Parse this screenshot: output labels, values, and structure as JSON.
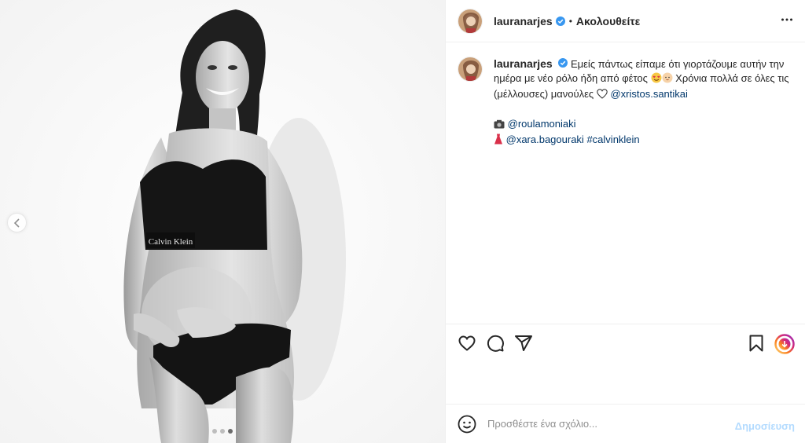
{
  "post": {
    "username": "lauranarjes",
    "follow_status": "Ακολουθείτε",
    "separator": "•",
    "caption": {
      "line1": "Εμείς πάντως είπαμε ότι γιορτάζουμε αυτήν την ημέρα με νέο ρόλο ήδη από φέτος",
      "line2": " Χρόνια πολλά σε όλες τις (μέλλουσες) μανούλες",
      "mention_main": "@xristos.santikai",
      "credit_photo": "@roulamoniaki",
      "credit_style": "@xara.bagouraki",
      "hashtag": "#calvinklein"
    },
    "photo_brand_text": "Calvin Klein",
    "carousel": {
      "count": 3,
      "active_index": 2
    }
  },
  "comment": {
    "placeholder": "Προσθέστε ένα σχόλιο...",
    "post_label": "Δημοσίευση"
  },
  "icons": {
    "verified": "verified-badge-icon",
    "more": "more-options-icon",
    "like": "heart-icon",
    "comment": "comment-icon",
    "share": "share-icon",
    "save": "bookmark-icon",
    "story": "story-ring-icon",
    "emoji": "emoji-icon",
    "prev": "chevron-left-icon"
  },
  "colors": {
    "link": "#00376b",
    "verified": "#3897f0",
    "post_button_disabled": "#b3dbff"
  }
}
